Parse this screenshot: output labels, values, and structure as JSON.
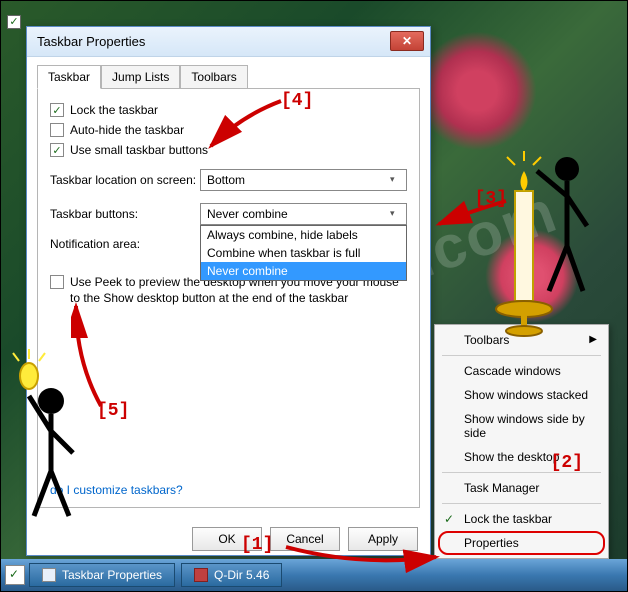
{
  "dialog": {
    "title": "Taskbar Properties",
    "tabs": [
      "Taskbar",
      "Jump Lists",
      "Toolbars"
    ],
    "checkboxes": {
      "lock": {
        "label": "Lock the taskbar",
        "checked": true
      },
      "autohide": {
        "label": "Auto-hide the taskbar",
        "checked": false
      },
      "small": {
        "label": "Use small taskbar buttons",
        "checked": true
      }
    },
    "location": {
      "label": "Taskbar location on screen:",
      "value": "Bottom"
    },
    "buttons": {
      "label": "Taskbar buttons:",
      "value": "Never combine",
      "options": [
        "Always combine, hide labels",
        "Combine when taskbar is full",
        "Never combine"
      ]
    },
    "notification_label": "Notification area:",
    "peek": {
      "checked": false,
      "text": "Use Peek to preview the desktop when you move your mouse to the Show desktop button at the end of the taskbar"
    },
    "help_link": "do I customize taskbars?",
    "buttons_bar": {
      "ok": "OK",
      "cancel": "Cancel",
      "apply": "Apply"
    }
  },
  "contextmenu": {
    "items": [
      "Toolbars",
      "Cascade windows",
      "Show windows stacked",
      "Show windows side by side",
      "Show the desktop",
      "Task Manager",
      "Lock the taskbar",
      "Properties"
    ]
  },
  "taskbar": {
    "items": [
      "Taskbar Properties",
      "Q-Dir 5.46"
    ]
  },
  "annotations": {
    "a1": "[1]",
    "a2": "[2]",
    "a3": "[3]",
    "a4": "[4]",
    "a5": "[5]"
  },
  "watermark": "SoftwareOK.com"
}
